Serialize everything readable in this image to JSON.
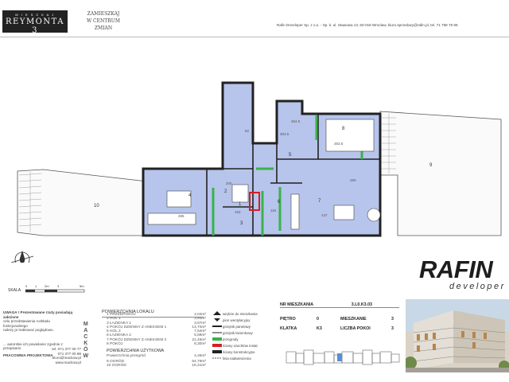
{
  "header": {
    "logo_top": "M I E S Z K A J",
    "logo_main": "REYMONTA 3",
    "slogan_lines": [
      "ZAMIESZKAJ",
      "W CENTRUM",
      "ZMIAN"
    ],
    "contact": "Rafin Developer Sp. z o.o. - Sp. k.  ul. Stawowa 13, 50-018 Wrocław, biuro.sprzedazy@rafin.pl, tel. 71 788 78 88"
  },
  "brand": {
    "name": "RAFIN",
    "sub": "developer"
  },
  "scale": {
    "label": "SKALA",
    "ticks": [
      "0",
      "1",
      "2m",
      "3",
      "5m"
    ]
  },
  "plan": {
    "labels": {
      "r1": "1",
      "r2": "2",
      "r3": "3",
      "r4": "4",
      "r5": "5",
      "r6": "6",
      "r7": "7",
      "r8": "8",
      "r9": "9",
      "r10": "10"
    },
    "dims": [
      "285",
      "304.5",
      "264.5",
      "263.5",
      "200",
      "116",
      "152",
      "82",
      "260",
      "147"
    ]
  },
  "notes": {
    "title": "UWAGA ! Prezentowane rzuty posiadają założone",
    "lines": [
      "celu przedstawienia rozkładu funkcjonalnego",
      "należy je traktować poglądowo."
    ],
    "contact_lines": [
      "tel. 071 377 00 77",
      "071 377 00 88",
      "biuro@mackow.pl",
      "www.mackow.pl",
      "ul. Podwale 41/1, 50-040 Wrocław"
    ],
    "vertical": [
      "M",
      "A",
      "C",
      "K",
      "Ó",
      "W"
    ],
    "small_left": "... autorskie ich powielanie zgodnie z przepisami",
    "designer": "PRACOWNIA PROJEKTOWA"
  },
  "area": {
    "title": "POWIERZCHNIA LOKALU",
    "rooms": [
      {
        "name": "1 PRZEDPOKÓJ",
        "value": "4,04m²"
      },
      {
        "name": "2 HOL 1",
        "value": "3,91m²"
      },
      {
        "name": "3 ŁAZIENKA 1",
        "value": "3,67m²"
      },
      {
        "name": "4 POKÓJ DZIENNY Z ANEKSEM 1",
        "value": "13,70m²"
      },
      {
        "name": "5 HOL 2",
        "value": "7,54m²"
      },
      {
        "name": "6 ŁAZIENKA 2",
        "value": "5,69m²"
      },
      {
        "name": "7 POKÓJ DZIENNY Z ANEKSEM 2",
        "value": "21,45m²"
      },
      {
        "name": "8 POKÓJ",
        "value": "8,30m²"
      }
    ],
    "usable_title": "POWIERZCHNIA UŻYTKOWA",
    "partition": "Powierzchnia przegród",
    "extras": [
      {
        "name": "9 OGRÓD",
        "value": "54,79m²"
      },
      {
        "name": "10 OGRÓD",
        "value": "15,31m²"
      }
    ],
    "total": "4,45m²"
  },
  "legend": [
    {
      "label": "wejście do mieszkania",
      "kind": "arrow"
    },
    {
      "label": "pion wentylacyjny",
      "kind": "fan"
    },
    {
      "label": "grzejnik panelowy",
      "kind": "line-black"
    },
    {
      "label": "grzejnik łazienkowy",
      "kind": "line-thin"
    },
    {
      "label": "przegrody",
      "kind": "green"
    },
    {
      "label": "ściany szachtów instal.",
      "kind": "red"
    },
    {
      "label": "ściany konstrukcyjne",
      "kind": "line-dark"
    },
    {
      "label": "linia nadwieszenia",
      "kind": "dash"
    }
  ],
  "apartment": {
    "title_label": "NR MIESZKANIA",
    "title_value": "3.L0.K3.03",
    "rows": [
      {
        "l1": "PIĘTRO",
        "v1": "0",
        "l2": "MIESZKANIE",
        "v2": "3"
      },
      {
        "l1": "KLATKA",
        "v1": "K3",
        "l2": "LICZBA POKOI",
        "v2": "3"
      }
    ]
  },
  "colors": {
    "room_fill": "#b7c4ec",
    "partition": "#37b34a",
    "shaft": "#d81e1e",
    "wall": "#222222",
    "garden_line": "#333333"
  }
}
